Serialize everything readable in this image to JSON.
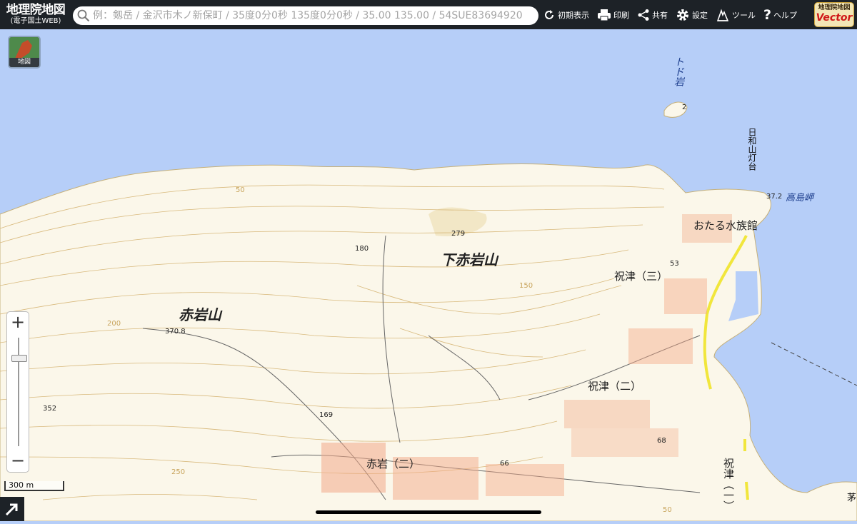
{
  "header": {
    "brand_title": "地理院地図",
    "brand_subtitle": "(電子国土WEB)",
    "search_placeholder": "例：剱岳 / 金沢市木ノ新保町 / 35度0分0秒 135度0分0秒 / 35.00 135.00 / 54SUE83694920",
    "tools": [
      {
        "icon": "reload-icon",
        "label": "初期表示"
      },
      {
        "icon": "printer-icon",
        "label": "印刷"
      },
      {
        "icon": "share-icon",
        "label": "共有"
      },
      {
        "icon": "gear-icon",
        "label": "設定"
      },
      {
        "icon": "tools-icon",
        "label": "ツール"
      },
      {
        "icon": "help-icon",
        "label": "ヘルプ"
      }
    ],
    "vector_button": {
      "line1": "地理院地図",
      "line2": "Vector"
    }
  },
  "layer_button": {
    "label": "地図"
  },
  "zoom": {
    "plus": "+",
    "minus": "−"
  },
  "scale_bar": {
    "label": "300 m"
  },
  "map_labels": {
    "mountain_shimo_akaiwa": "下赤岩山",
    "mountain_akaiwa": "赤岩山",
    "district_akaiwa_2": "赤岩（二）",
    "district_iwainai_3": "祝津（三）",
    "district_iwainai_2": "祝津（二）",
    "district_iwainai_1": "祝津（一）",
    "aquarium": "おたる水族館",
    "todo_rock": "トド岩",
    "lighthouse": "日和山灯台",
    "takashima_cape": "高島岬",
    "edge_char": "茅",
    "elev_279": "279",
    "elev_180": "180",
    "elev_370": "370.8",
    "elev_352": "352",
    "elev_169": "169",
    "elev_66": "66",
    "elev_68": "68",
    "elev_53": "53",
    "elev_37": "37.2",
    "elev_2": "2",
    "contour_50": "50",
    "contour_150": "150",
    "contour_200": "200",
    "contour_250": "250",
    "contour_50b": "50"
  },
  "colors": {
    "sea": "#b6cef8",
    "land": "#fbf7ea",
    "contour": "#d8b97c",
    "road_highlight": "#f1e63c",
    "building": "#f3a988",
    "toolbar": "#1d2227"
  }
}
